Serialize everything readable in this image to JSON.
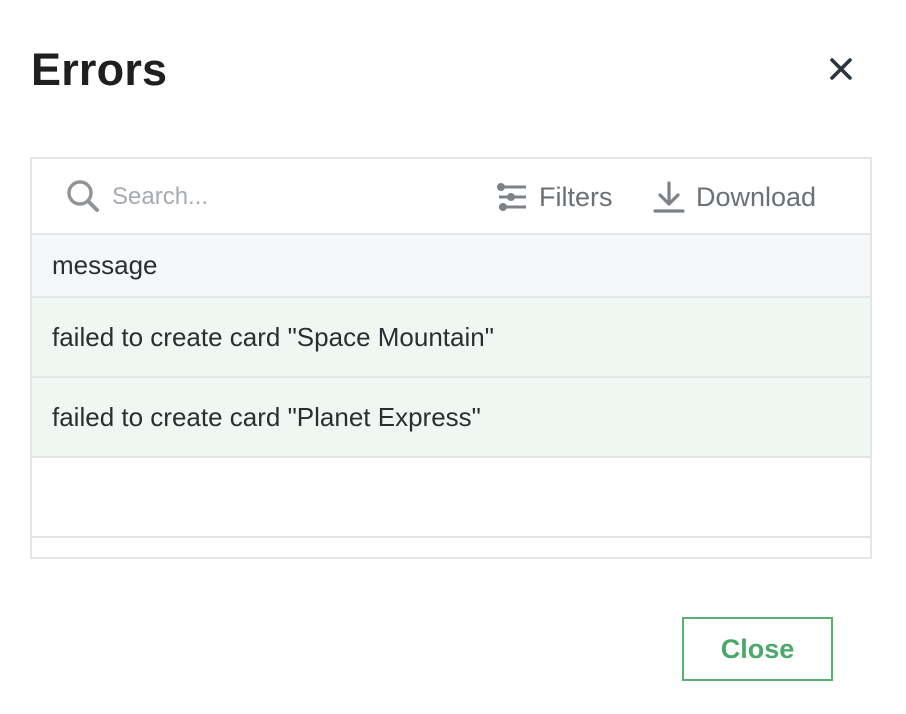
{
  "modal": {
    "title": "Errors",
    "close_icon": "close-x-icon"
  },
  "toolbar": {
    "search": {
      "placeholder": "Search...",
      "value": "",
      "icon": "search-icon"
    },
    "filters_label": "Filters",
    "filters_icon": "sliders-icon",
    "download_label": "Download",
    "download_icon": "download-icon"
  },
  "table": {
    "columns": [
      "message"
    ],
    "rows": [
      {
        "message": "failed to create card \"Space Mountain\""
      },
      {
        "message": "failed to create card \"Planet Express\""
      }
    ]
  },
  "footer": {
    "close_label": "Close"
  },
  "colors": {
    "accent": "#55b273",
    "error_row_bg": "#eef7f1",
    "header_bg": "#f6f7f9",
    "border": "#e3e6e9"
  }
}
